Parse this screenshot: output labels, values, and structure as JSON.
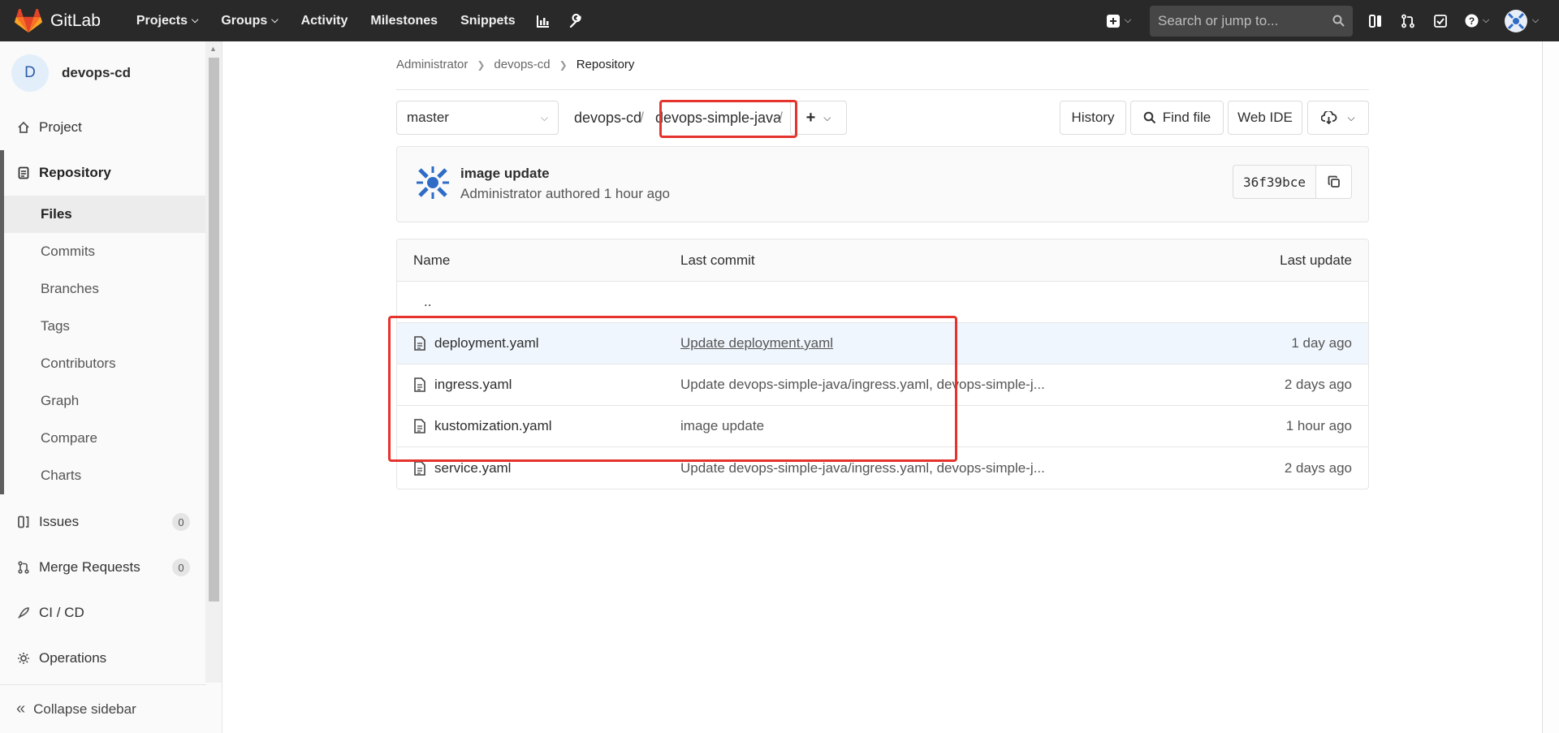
{
  "navbar": {
    "brand": "GitLab",
    "links": [
      {
        "label": "Projects",
        "caret": true
      },
      {
        "label": "Groups",
        "caret": true
      },
      {
        "label": "Activity",
        "caret": false
      },
      {
        "label": "Milestones",
        "caret": false
      },
      {
        "label": "Snippets",
        "caret": false
      }
    ],
    "search_placeholder": "Search or jump to..."
  },
  "sidebar": {
    "avatar_letter": "D",
    "project_name": "devops-cd",
    "project": "Project",
    "repository": "Repository",
    "repo_items": [
      "Files",
      "Commits",
      "Branches",
      "Tags",
      "Contributors",
      "Graph",
      "Compare",
      "Charts"
    ],
    "issues": {
      "label": "Issues",
      "count": "0"
    },
    "merge_requests": {
      "label": "Merge Requests",
      "count": "0"
    },
    "cicd": "CI / CD",
    "operations": "Operations",
    "collapse": "Collapse sidebar"
  },
  "breadcrumb": {
    "items": [
      "Administrator",
      "devops-cd",
      "Repository"
    ]
  },
  "tree": {
    "branch": "master",
    "path_root": "devops-cd",
    "path_dir": "devops-simple-java",
    "sep": "/",
    "history": "History",
    "find_file": "Find file",
    "web_ide": "Web IDE"
  },
  "last_commit": {
    "title": "image update",
    "author": "Administrator authored 1 hour ago",
    "sha": "36f39bce"
  },
  "table": {
    "headers": {
      "name": "Name",
      "last_commit": "Last commit",
      "last_update": "Last update"
    },
    "parent": "..",
    "rows": [
      {
        "name": "deployment.yaml",
        "commit": "Update deployment.yaml",
        "updated": "1 day ago"
      },
      {
        "name": "ingress.yaml",
        "commit": "Update devops-simple-java/ingress.yaml, devops-simple-j...",
        "updated": "2 days ago"
      },
      {
        "name": "kustomization.yaml",
        "commit": "image update",
        "updated": "1 hour ago"
      },
      {
        "name": "service.yaml",
        "commit": "Update devops-simple-java/ingress.yaml, devops-simple-j...",
        "updated": "2 days ago"
      }
    ]
  },
  "colors": {
    "navbar": "#292929",
    "highlight": "#e5332d",
    "row_hover": "#f0f6fd"
  }
}
